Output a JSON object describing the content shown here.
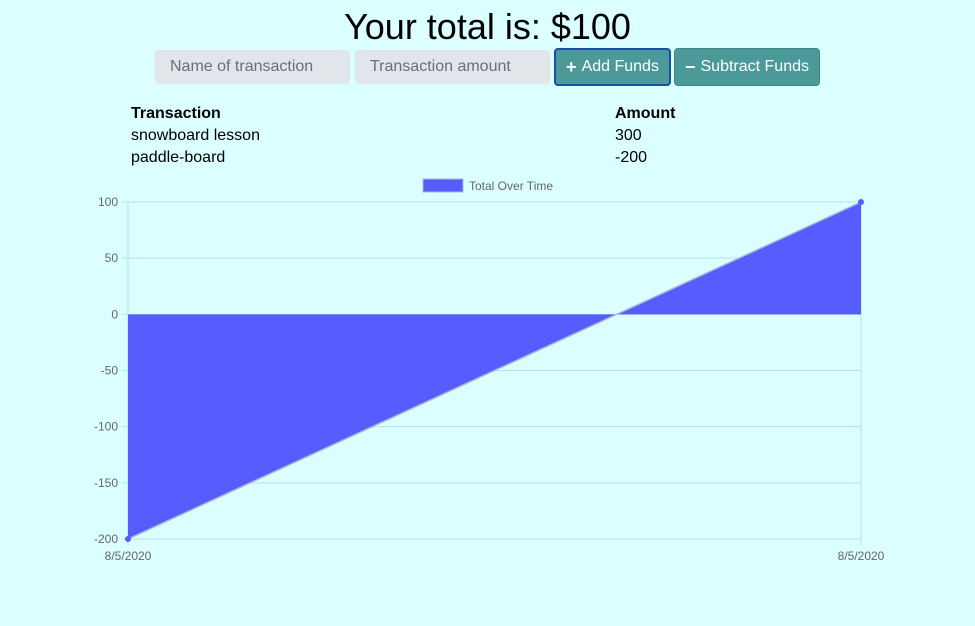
{
  "header": {
    "total_text": "Your total is: $100"
  },
  "form": {
    "name_placeholder": "Name of transaction",
    "amount_placeholder": "Transaction amount",
    "add_label": "Add Funds",
    "add_icon": "+",
    "subtract_label": "Subtract Funds",
    "subtract_icon": "−"
  },
  "table": {
    "headers": [
      "Transaction",
      "Amount"
    ],
    "rows": [
      {
        "name": "snowboard lesson",
        "amount": "300"
      },
      {
        "name": "paddle-board",
        "amount": "-200"
      }
    ]
  },
  "colors": {
    "background": "#dbffff",
    "button": "#4c9999",
    "series": "#575cff",
    "input": "#e1e6eb"
  },
  "chart_data": {
    "type": "area",
    "x": [
      "8/5/2020",
      "8/5/2020"
    ],
    "series": [
      {
        "name": "Total Over Time",
        "values": [
          -200,
          100
        ]
      }
    ],
    "yticks": [
      100,
      50,
      0,
      -50,
      -100,
      -150,
      -200
    ],
    "ylim": [
      -200,
      100
    ],
    "grid": true,
    "legend": "top-center"
  }
}
